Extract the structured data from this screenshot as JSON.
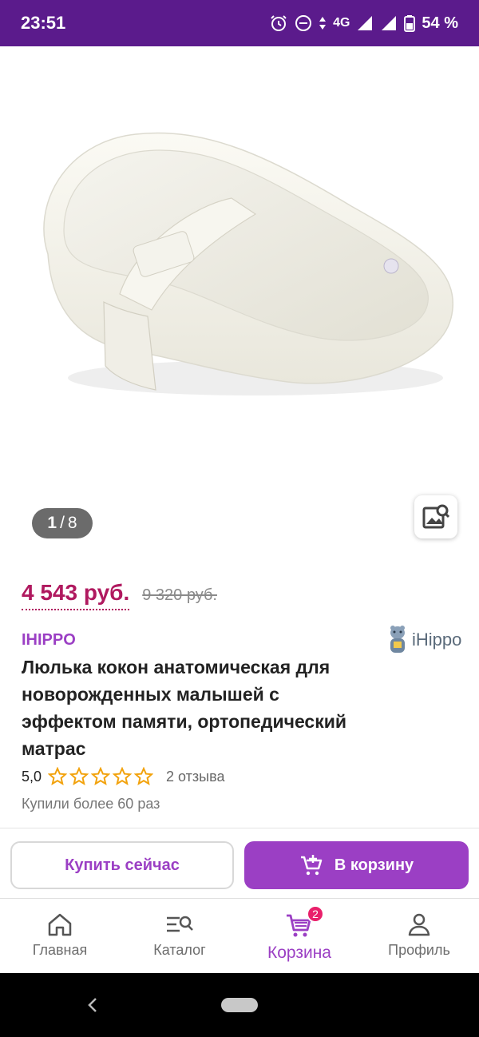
{
  "status_bar": {
    "time": "23:51",
    "network": "4G",
    "battery": "54 %"
  },
  "gallery": {
    "current": "1",
    "separator": "/",
    "total": "8",
    "image_icon": "mattress-cocoon-image"
  },
  "product": {
    "price": "4 543 руб.",
    "old_price": "9 320 руб.",
    "brand": "IHIPPO",
    "brand_logo_text": "iHippo",
    "title": "Люлька кокон анатомическая для новорожденных малышей с эффектом памяти, ортопедический матрас",
    "rating": "5,0",
    "stars": 5,
    "reviews": "2 отзыва",
    "bought": "Купили более 60 раз"
  },
  "actions": {
    "buy_now": "Купить сейчас",
    "add_to_cart": "В корзину"
  },
  "bottom_nav": {
    "items": [
      {
        "label": "Главная",
        "icon": "home-icon"
      },
      {
        "label": "Каталог",
        "icon": "catalog-search-icon"
      },
      {
        "label": "Корзина",
        "icon": "cart-icon",
        "badge": "2"
      },
      {
        "label": "Профиль",
        "icon": "profile-icon"
      }
    ]
  },
  "colors": {
    "status_bar": "#5b1b8c",
    "accent": "#9b3fc4",
    "price": "#b0195f",
    "badge": "#e9206b"
  }
}
